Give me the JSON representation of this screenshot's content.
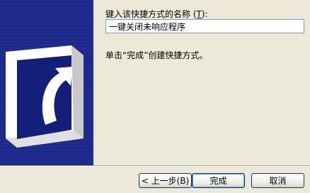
{
  "dialog": {
    "name_label_text": "键入该快捷方式的名称 (",
    "name_label_hotkey": "T",
    "name_label_suffix": "):",
    "name_value": "一键关闭未响应程序",
    "hint": "单击“完成”创建快捷方式。"
  },
  "buttons": {
    "back": "< 上一步(B)",
    "finish": "完成",
    "cancel": "取消"
  },
  "colors": {
    "banner": "#141f7a",
    "face": "#ece9d8",
    "button_border": "#003c74"
  },
  "icons": {
    "banner": "shortcut-arrow-icon"
  }
}
